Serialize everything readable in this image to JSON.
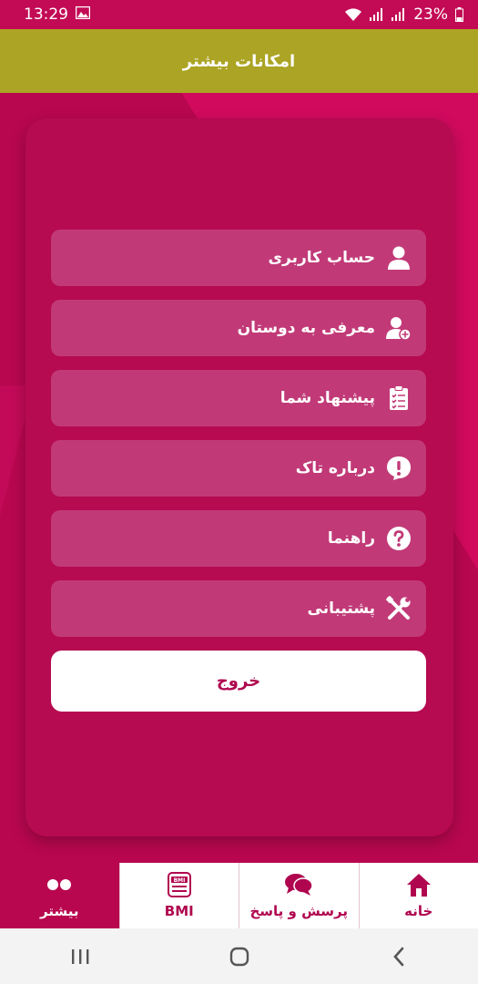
{
  "status_bar": {
    "time": "13:29",
    "battery": "23%"
  },
  "app_bar": {
    "title": "امکانات بیشتر"
  },
  "menu": [
    {
      "label": "حساب کاربری",
      "icon": "user-icon"
    },
    {
      "label": "معرفی به دوستان",
      "icon": "add-user-icon"
    },
    {
      "label": "پیشنهاد شما",
      "icon": "clipboard-icon"
    },
    {
      "label": "درباره تاک",
      "icon": "info-exclamation-icon"
    },
    {
      "label": "راهنما",
      "icon": "question-icon"
    },
    {
      "label": "پشتیبانی",
      "icon": "tools-icon"
    }
  ],
  "logout": {
    "label": "خروج"
  },
  "bottom_nav": [
    {
      "label": "خانه",
      "icon": "home-icon"
    },
    {
      "label": "پرسش و پاسخ",
      "icon": "chat-icon"
    },
    {
      "label": "BMI",
      "icon": "scale-icon"
    },
    {
      "label": "بیشتر",
      "icon": "more-dots-icon",
      "active": true
    }
  ],
  "colors": {
    "primary": "#b8074f",
    "app_bar": "#aba424",
    "menu_item": "#c13a77",
    "white": "#ffffff"
  }
}
